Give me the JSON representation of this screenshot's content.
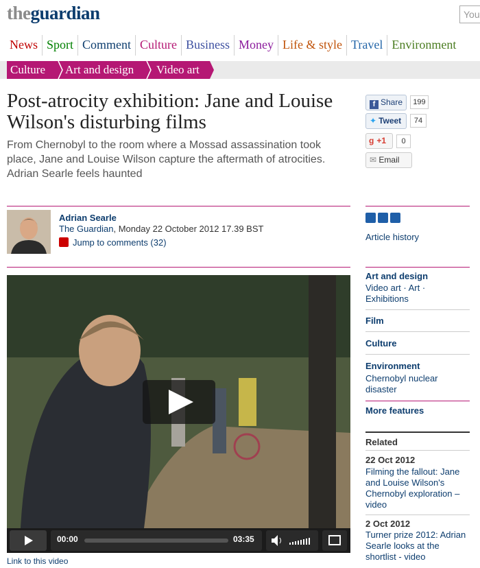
{
  "header": {
    "logo_the": "the",
    "logo_guardian": "guardian",
    "search_placeholder": "You"
  },
  "nav": [
    {
      "label": "News",
      "color": "#c00000"
    },
    {
      "label": "Sport",
      "color": "#008000"
    },
    {
      "label": "Comment",
      "color": "#0d3d6e"
    },
    {
      "label": "Culture",
      "color": "#b51874"
    },
    {
      "label": "Business",
      "color": "#3c4fa0"
    },
    {
      "label": "Money",
      "color": "#8c1c9c"
    },
    {
      "label": "Life & style",
      "color": "#c0530a"
    },
    {
      "label": "Travel",
      "color": "#2466a8"
    },
    {
      "label": "Environment",
      "color": "#4a7c20"
    }
  ],
  "breadcrumb": [
    "Culture",
    "Art and design",
    "Video art"
  ],
  "article": {
    "headline": "Post-atrocity exhibition: Jane and Louise Wilson's disturbing films",
    "standfirst": "From Chernobyl to the room where a Mossad assassination took place, Jane and Louise Wilson capture the aftermath of atrocities. Adrian Searle feels haunted",
    "author": "Adrian Searle",
    "publication": "The Guardian",
    "date": ", Monday 22 October 2012 17.39 BST",
    "jump": "Jump to comments (32)"
  },
  "video": {
    "time_current": "00:00",
    "time_total": "03:35",
    "link": "Link to this video"
  },
  "share": {
    "facebook": "Share",
    "facebook_count": "199",
    "twitter": "Tweet",
    "twitter_count": "74",
    "gplus": "+1",
    "gplus_count": "0",
    "email": "Email"
  },
  "sidebar": {
    "history": "Article history",
    "art_design": "Art and design",
    "art_links": "Video art · Art · Exhibitions",
    "film": "Film",
    "culture": "Culture",
    "environment": "Environment",
    "env_links": "Chernobyl nuclear disaster",
    "more": "More features",
    "related": "Related",
    "rel1_date": "22 Oct 2012",
    "rel1_title": "Filming the fallout: Jane and Louise Wilson's Chernobyl exploration – video",
    "rel2_date": "2 Oct 2012",
    "rel2_title": "Turner prize 2012: Adrian Searle looks at the shortlist - video"
  },
  "colors": {
    "accent": "#b51874",
    "link": "#0d3d6e"
  }
}
